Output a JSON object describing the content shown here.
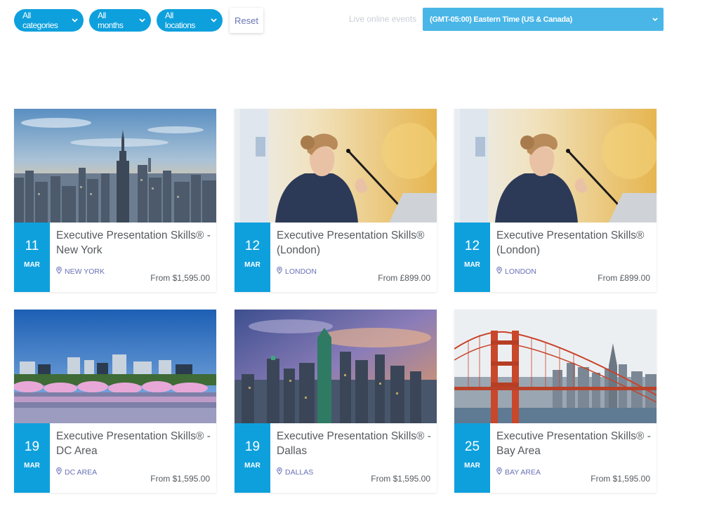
{
  "filters": {
    "categories_label": "All categories",
    "months_label": "All months",
    "locations_label": "All locations",
    "reset_label": "Reset",
    "live_events_label": "Live online events",
    "timezone_value": "(GMT-05:00) Eastern Time (US & Canada)"
  },
  "colors": {
    "accent": "#0ea0dd",
    "timezone_bg": "#4ab6e8",
    "location_text": "#6870b8"
  },
  "events": [
    {
      "day": "11",
      "month": "MAR",
      "title": "Executive Presentation Skills® - New York",
      "location": "NEW YORK",
      "price": "From $1,595.00",
      "image": "new-york-skyline"
    },
    {
      "day": "12",
      "month": "MAR",
      "title": "Executive Presentation Skills® (London)",
      "location": "LONDON",
      "price": "From £899.00",
      "image": "speaker-at-podium"
    },
    {
      "day": "12",
      "month": "MAR",
      "title": "Executive Presentation Skills® (London)",
      "location": "LONDON",
      "price": "From £899.00",
      "image": "speaker-at-podium"
    },
    {
      "day": "19",
      "month": "MAR",
      "title": "Executive Presentation Skills® - DC Area",
      "location": "DC AREA",
      "price": "From $1,595.00",
      "image": "dc-cherry-blossoms"
    },
    {
      "day": "19",
      "month": "MAR",
      "title": "Executive Presentation Skills® - Dallas",
      "location": "DALLAS",
      "price": "From $1,595.00",
      "image": "dallas-skyline"
    },
    {
      "day": "25",
      "month": "MAR",
      "title": "Executive Presentation Skills® - Bay Area",
      "location": "BAY AREA",
      "price": "From $1,595.00",
      "image": "golden-gate-bridge"
    }
  ]
}
